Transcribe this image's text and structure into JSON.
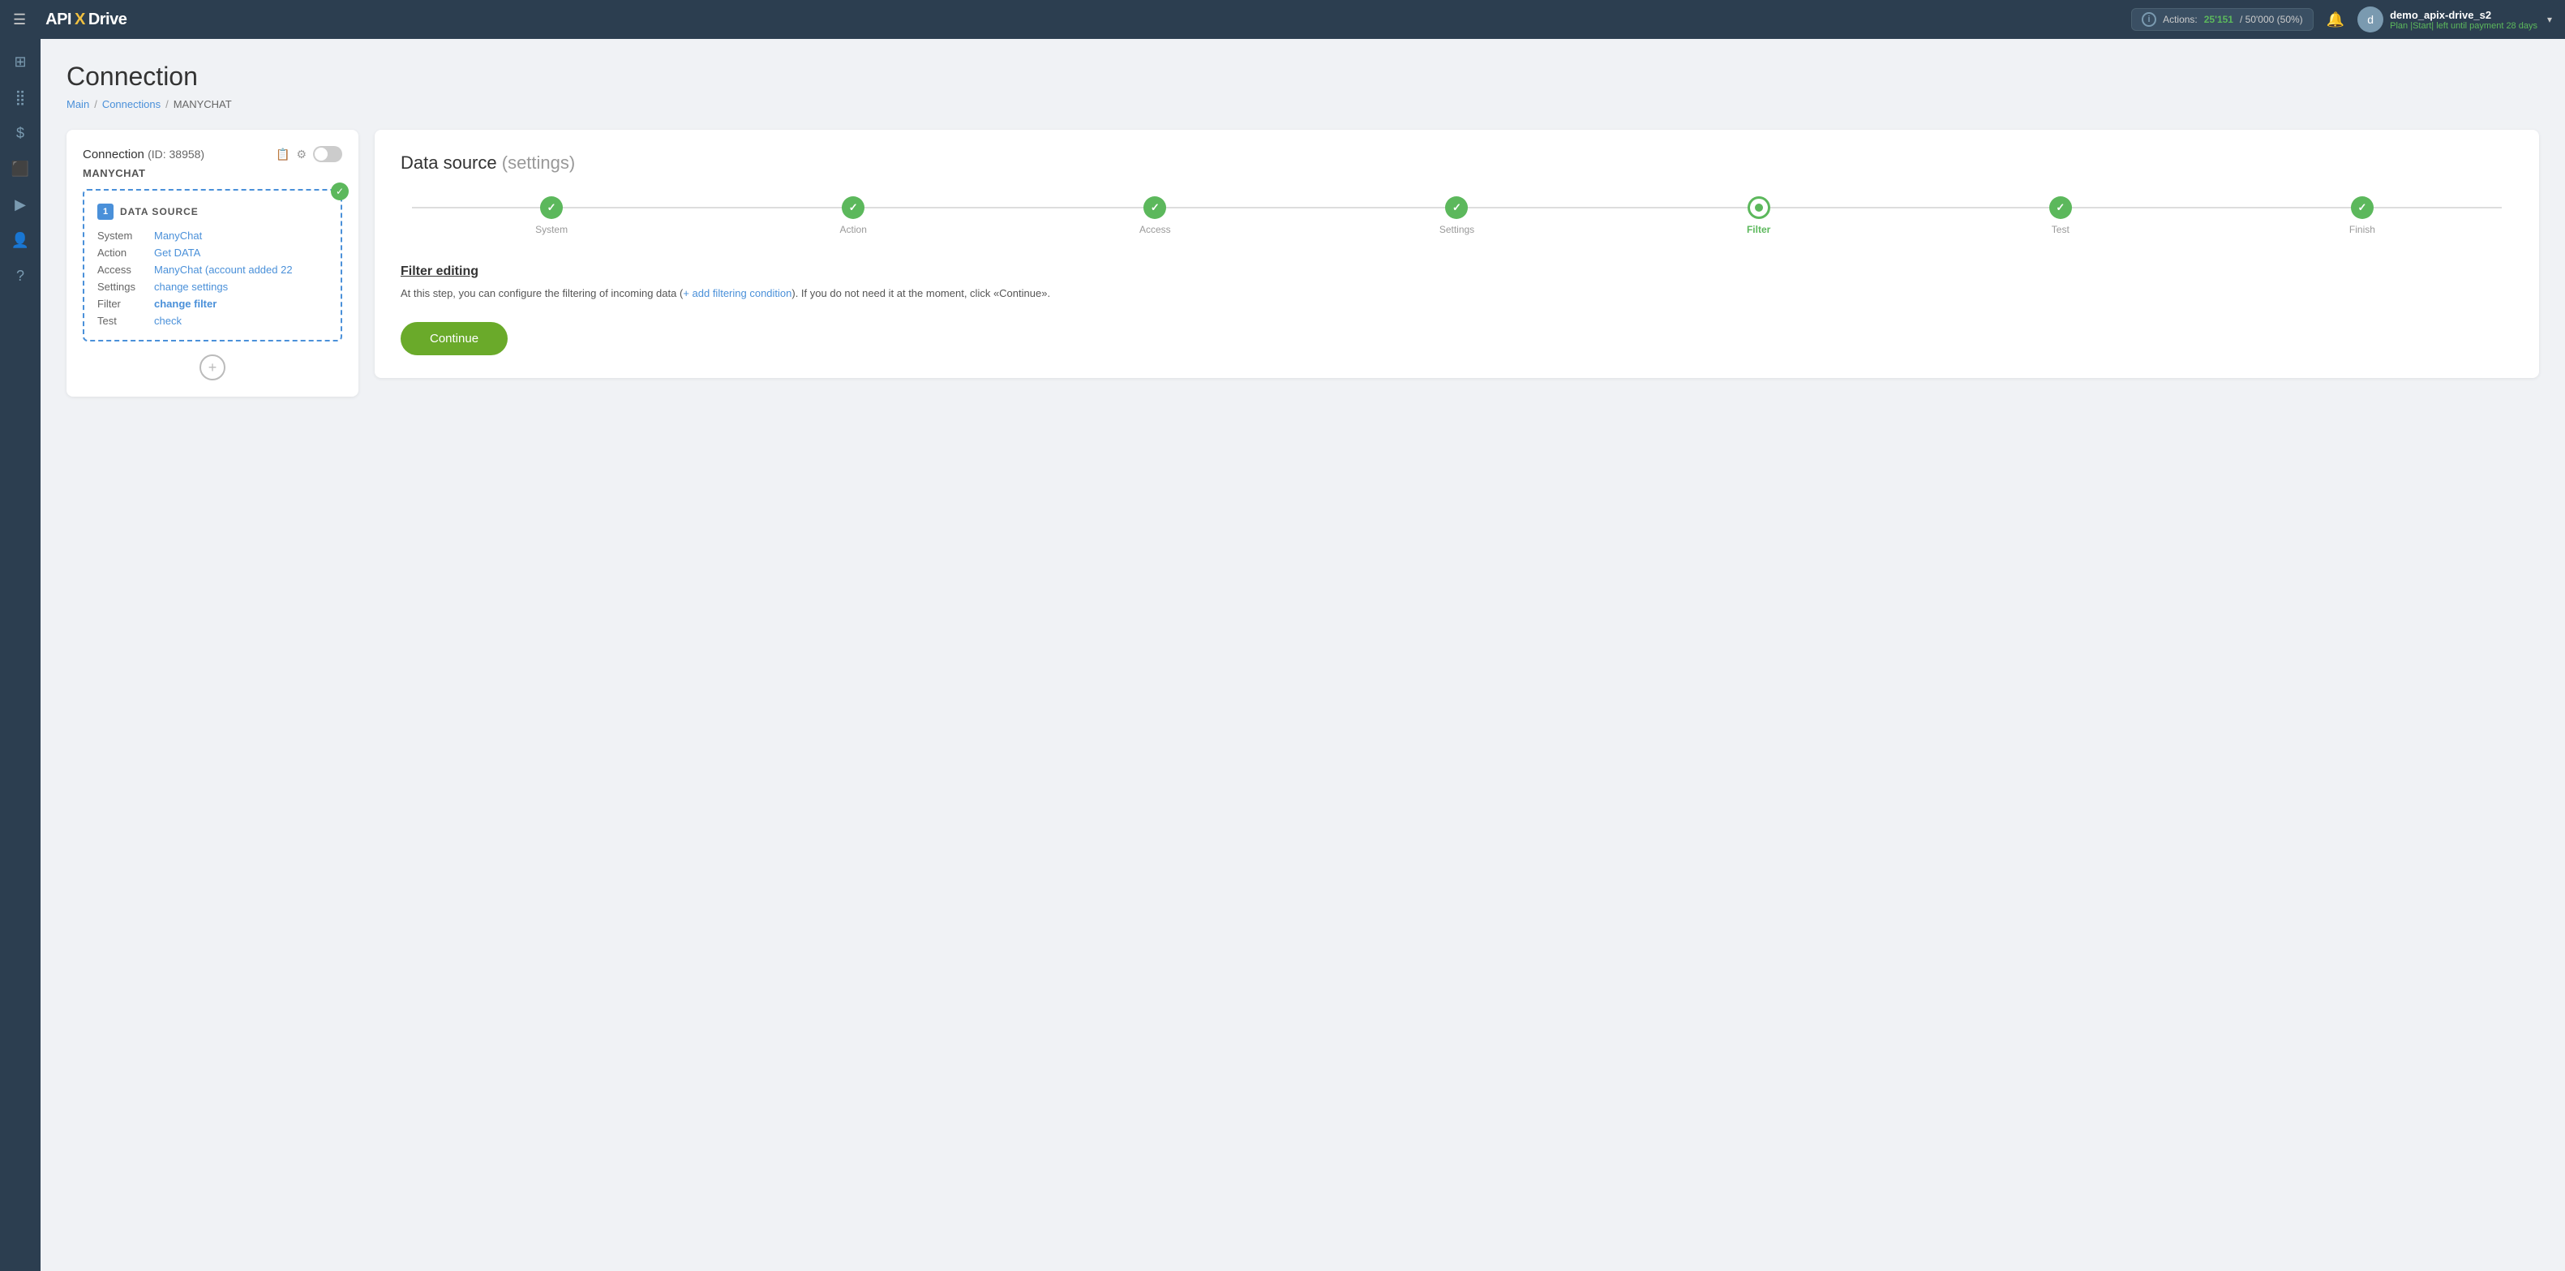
{
  "topnav": {
    "hamburger": "☰",
    "logo_text1": "API",
    "logo_x": "X",
    "logo_text2": "Drive",
    "actions_label": "Actions:",
    "actions_current": "25'151",
    "actions_separator": "/",
    "actions_total": "50'000",
    "actions_percent": "(50%)",
    "info_icon": "i",
    "bell_icon": "🔔",
    "user_initial": "d",
    "username": "demo_apix-drive_s2",
    "plan_label": "Plan",
    "plan_type": "Start",
    "plan_separator": "|",
    "plan_left": "left until payment",
    "plan_days": "28 days",
    "chevron": "▾"
  },
  "sidebar": {
    "items": [
      {
        "icon": "⊞",
        "name": "home-icon"
      },
      {
        "icon": "⊟",
        "name": "flow-icon"
      },
      {
        "icon": "$",
        "name": "billing-icon"
      },
      {
        "icon": "💼",
        "name": "briefcase-icon"
      },
      {
        "icon": "▶",
        "name": "play-icon"
      },
      {
        "icon": "👤",
        "name": "user-icon"
      },
      {
        "icon": "?",
        "name": "help-icon"
      }
    ]
  },
  "page": {
    "title": "Connection",
    "breadcrumb": {
      "main": "Main",
      "connections": "Connections",
      "current": "MANYCHAT"
    }
  },
  "left_panel": {
    "title": "Connection",
    "id_text": "(ID: 38958)",
    "connection_name": "MANYCHAT",
    "card": {
      "number": "1",
      "label": "DATA SOURCE",
      "rows": [
        {
          "key": "System",
          "value": "ManyChat"
        },
        {
          "key": "Action",
          "value": "Get DATA"
        },
        {
          "key": "Access",
          "value": "ManyChat (account added 22"
        },
        {
          "key": "Settings",
          "value": "change settings"
        },
        {
          "key": "Filter",
          "value": "change filter"
        },
        {
          "key": "Test",
          "value": "check"
        }
      ]
    },
    "add_icon": "+"
  },
  "right_panel": {
    "title": "Data source",
    "title_suffix": "(settings)",
    "steps": [
      {
        "label": "System",
        "state": "done"
      },
      {
        "label": "Action",
        "state": "done"
      },
      {
        "label": "Access",
        "state": "done"
      },
      {
        "label": "Settings",
        "state": "done"
      },
      {
        "label": "Filter",
        "state": "active"
      },
      {
        "label": "Test",
        "state": "done"
      },
      {
        "label": "Finish",
        "state": "done"
      }
    ],
    "filter_title": "Filter editing",
    "filter_desc_before": "At this step, you can configure the filtering of incoming data (",
    "filter_link": "+ add filtering condition",
    "filter_desc_after": "). If you do not need it at the moment, click «Continue».",
    "continue_btn": "Continue"
  }
}
